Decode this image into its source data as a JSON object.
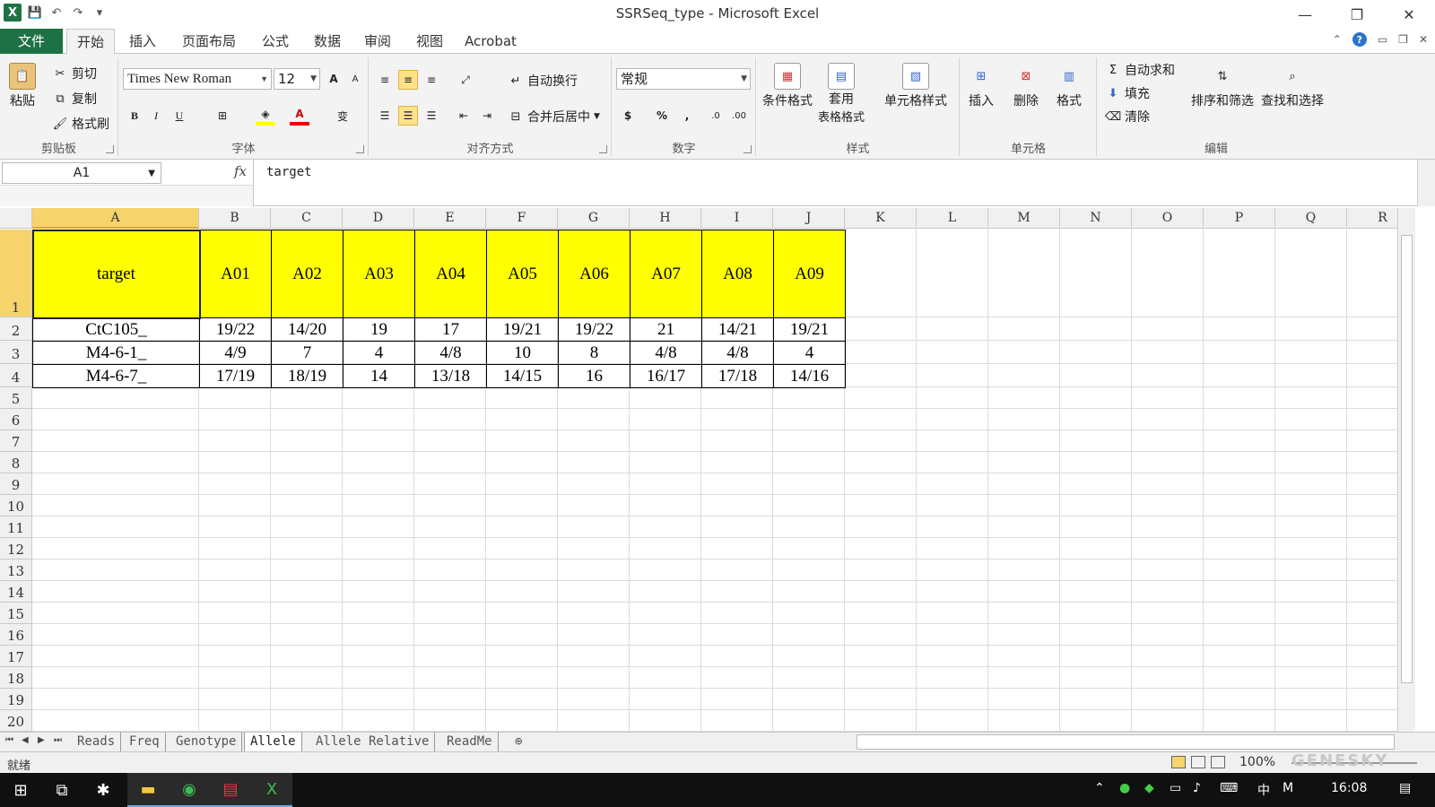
{
  "window": {
    "title": "SSRSeq_type - Microsoft Excel",
    "minimize": "—",
    "restore": "❐",
    "close": "✕"
  },
  "qat": {
    "save": "💾",
    "undo": "↶",
    "redo": "↷",
    "more": "▾"
  },
  "tabs": [
    {
      "id": "file",
      "label": "文件"
    },
    {
      "id": "home",
      "label": "开始"
    },
    {
      "id": "insert",
      "label": "插入"
    },
    {
      "id": "layout",
      "label": "页面布局"
    },
    {
      "id": "formula",
      "label": "公式"
    },
    {
      "id": "data",
      "label": "数据"
    },
    {
      "id": "review",
      "label": "审阅"
    },
    {
      "id": "view",
      "label": "视图"
    },
    {
      "id": "acrobat",
      "label": "Acrobat"
    }
  ],
  "ribbon": {
    "clipboard": {
      "label": "剪贴板",
      "paste": "粘贴",
      "cut": "剪切",
      "copy": "复制",
      "format_painter": "格式刷"
    },
    "font": {
      "label": "字体",
      "name": "Times New Roman",
      "size": "12",
      "bold": "B",
      "italic": "I",
      "underline": "U",
      "grow": "A",
      "shrink": "A",
      "font_color": "A",
      "wen": "变"
    },
    "alignment": {
      "label": "对齐方式",
      "wrap": "自动换行",
      "merge": "合并后居中"
    },
    "number": {
      "label": "数字",
      "format": "常规",
      "currency": "$",
      "percent": "%",
      "comma": ",",
      "inc": ".0",
      "dec": ".00"
    },
    "styles": {
      "label": "样式",
      "conditional": "条件格式",
      "table_line1": "套用",
      "table_line2": "表格格式",
      "cell_style": "单元格样式"
    },
    "cells": {
      "label": "单元格",
      "insert": "插入",
      "delete": "删除",
      "format": "格式"
    },
    "editing": {
      "label": "编辑",
      "autosum": "自动求和",
      "fill": "填充",
      "clear": "清除",
      "sort": "排序和筛选",
      "find": "查找和选择"
    }
  },
  "formula_bar": {
    "name_box": "A1",
    "fx": "fx",
    "content": "target"
  },
  "columns": [
    "A",
    "B",
    "C",
    "D",
    "E",
    "F",
    "G",
    "H",
    "I",
    "J",
    "K",
    "L",
    "M",
    "N",
    "O",
    "P",
    "Q",
    "R"
  ],
  "rows": [
    "1",
    "2",
    "3",
    "4",
    "5",
    "6",
    "7",
    "8",
    "9",
    "10",
    "11",
    "12",
    "13",
    "14",
    "15",
    "16",
    "17",
    "18",
    "19",
    "20"
  ],
  "table": {
    "header": [
      "target",
      "A01",
      "A02",
      "A03",
      "A04",
      "A05",
      "A06",
      "A07",
      "A08",
      "A09"
    ],
    "data": [
      [
        "CtC105_",
        "19/22",
        "14/20",
        "19",
        "17",
        "19/21",
        "19/22",
        "21",
        "14/21",
        "19/21"
      ],
      [
        "M4-6-1_",
        "4/9",
        "7",
        "4",
        "4/8",
        "10",
        "8",
        "4/8",
        "4/8",
        "4"
      ],
      [
        "M4-6-7_",
        "17/19",
        "18/19",
        "14",
        "13/18",
        "14/15",
        "16",
        "16/17",
        "17/18",
        "14/16"
      ]
    ]
  },
  "sheets": [
    {
      "name": "Reads",
      "active": false
    },
    {
      "name": "Freq",
      "active": false
    },
    {
      "name": "Genotype",
      "active": false
    },
    {
      "name": "Allele",
      "active": true
    },
    {
      "name": "Allele Relative",
      "active": false
    },
    {
      "name": "ReadMe",
      "active": false
    }
  ],
  "status": {
    "ready": "就绪",
    "zoom": "100%"
  },
  "watermark": "GENESKY",
  "taskbar": {
    "ime": "中",
    "clock": "16:08"
  },
  "colors": {
    "file_tab": "#1e7145",
    "header_fill": "#ffff00",
    "selected_header": "#f7d36c"
  }
}
